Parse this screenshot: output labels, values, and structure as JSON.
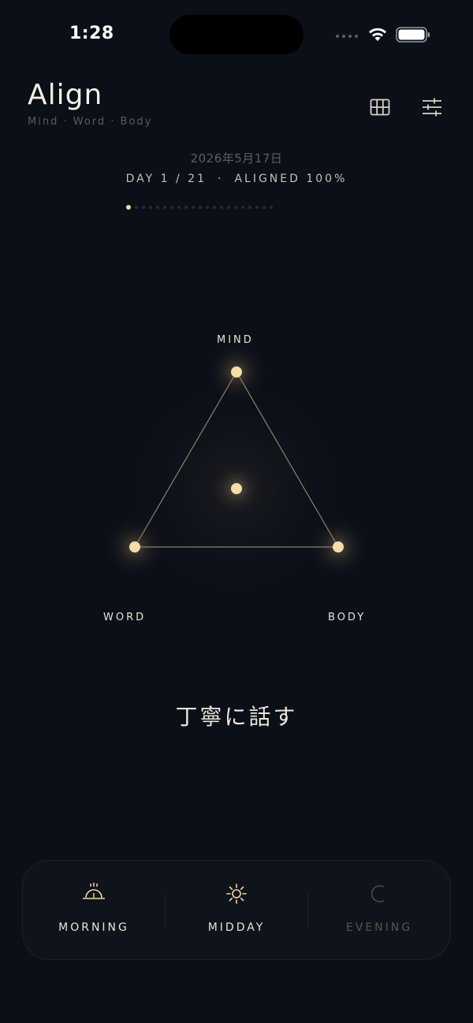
{
  "status": {
    "time": "1:28"
  },
  "header": {
    "title": "Align",
    "subtitle": "Mind · Word · Body",
    "grid_icon": "grid-icon",
    "settings_icon": "sliders-icon"
  },
  "date": "2026年5月17日",
  "progress": {
    "day": "DAY 1 / 21",
    "separator": "·",
    "aligned": "ALIGNED 100%"
  },
  "day_dots": {
    "total": 21,
    "current": 1
  },
  "triangle": {
    "mind_label": "MIND",
    "word_label": "WORD",
    "body_label": "BODY"
  },
  "phrase": "丁寧に話す",
  "periods": [
    {
      "label": "MORNING",
      "icon": "sunrise-icon",
      "active": true
    },
    {
      "label": "MIDDAY",
      "icon": "sun-icon",
      "active": true
    },
    {
      "label": "EVENING",
      "icon": "moon-icon",
      "active": false
    }
  ],
  "colors": {
    "background": "#0b0f18",
    "accent": "#f3d9a8",
    "line": "#8f8167"
  }
}
